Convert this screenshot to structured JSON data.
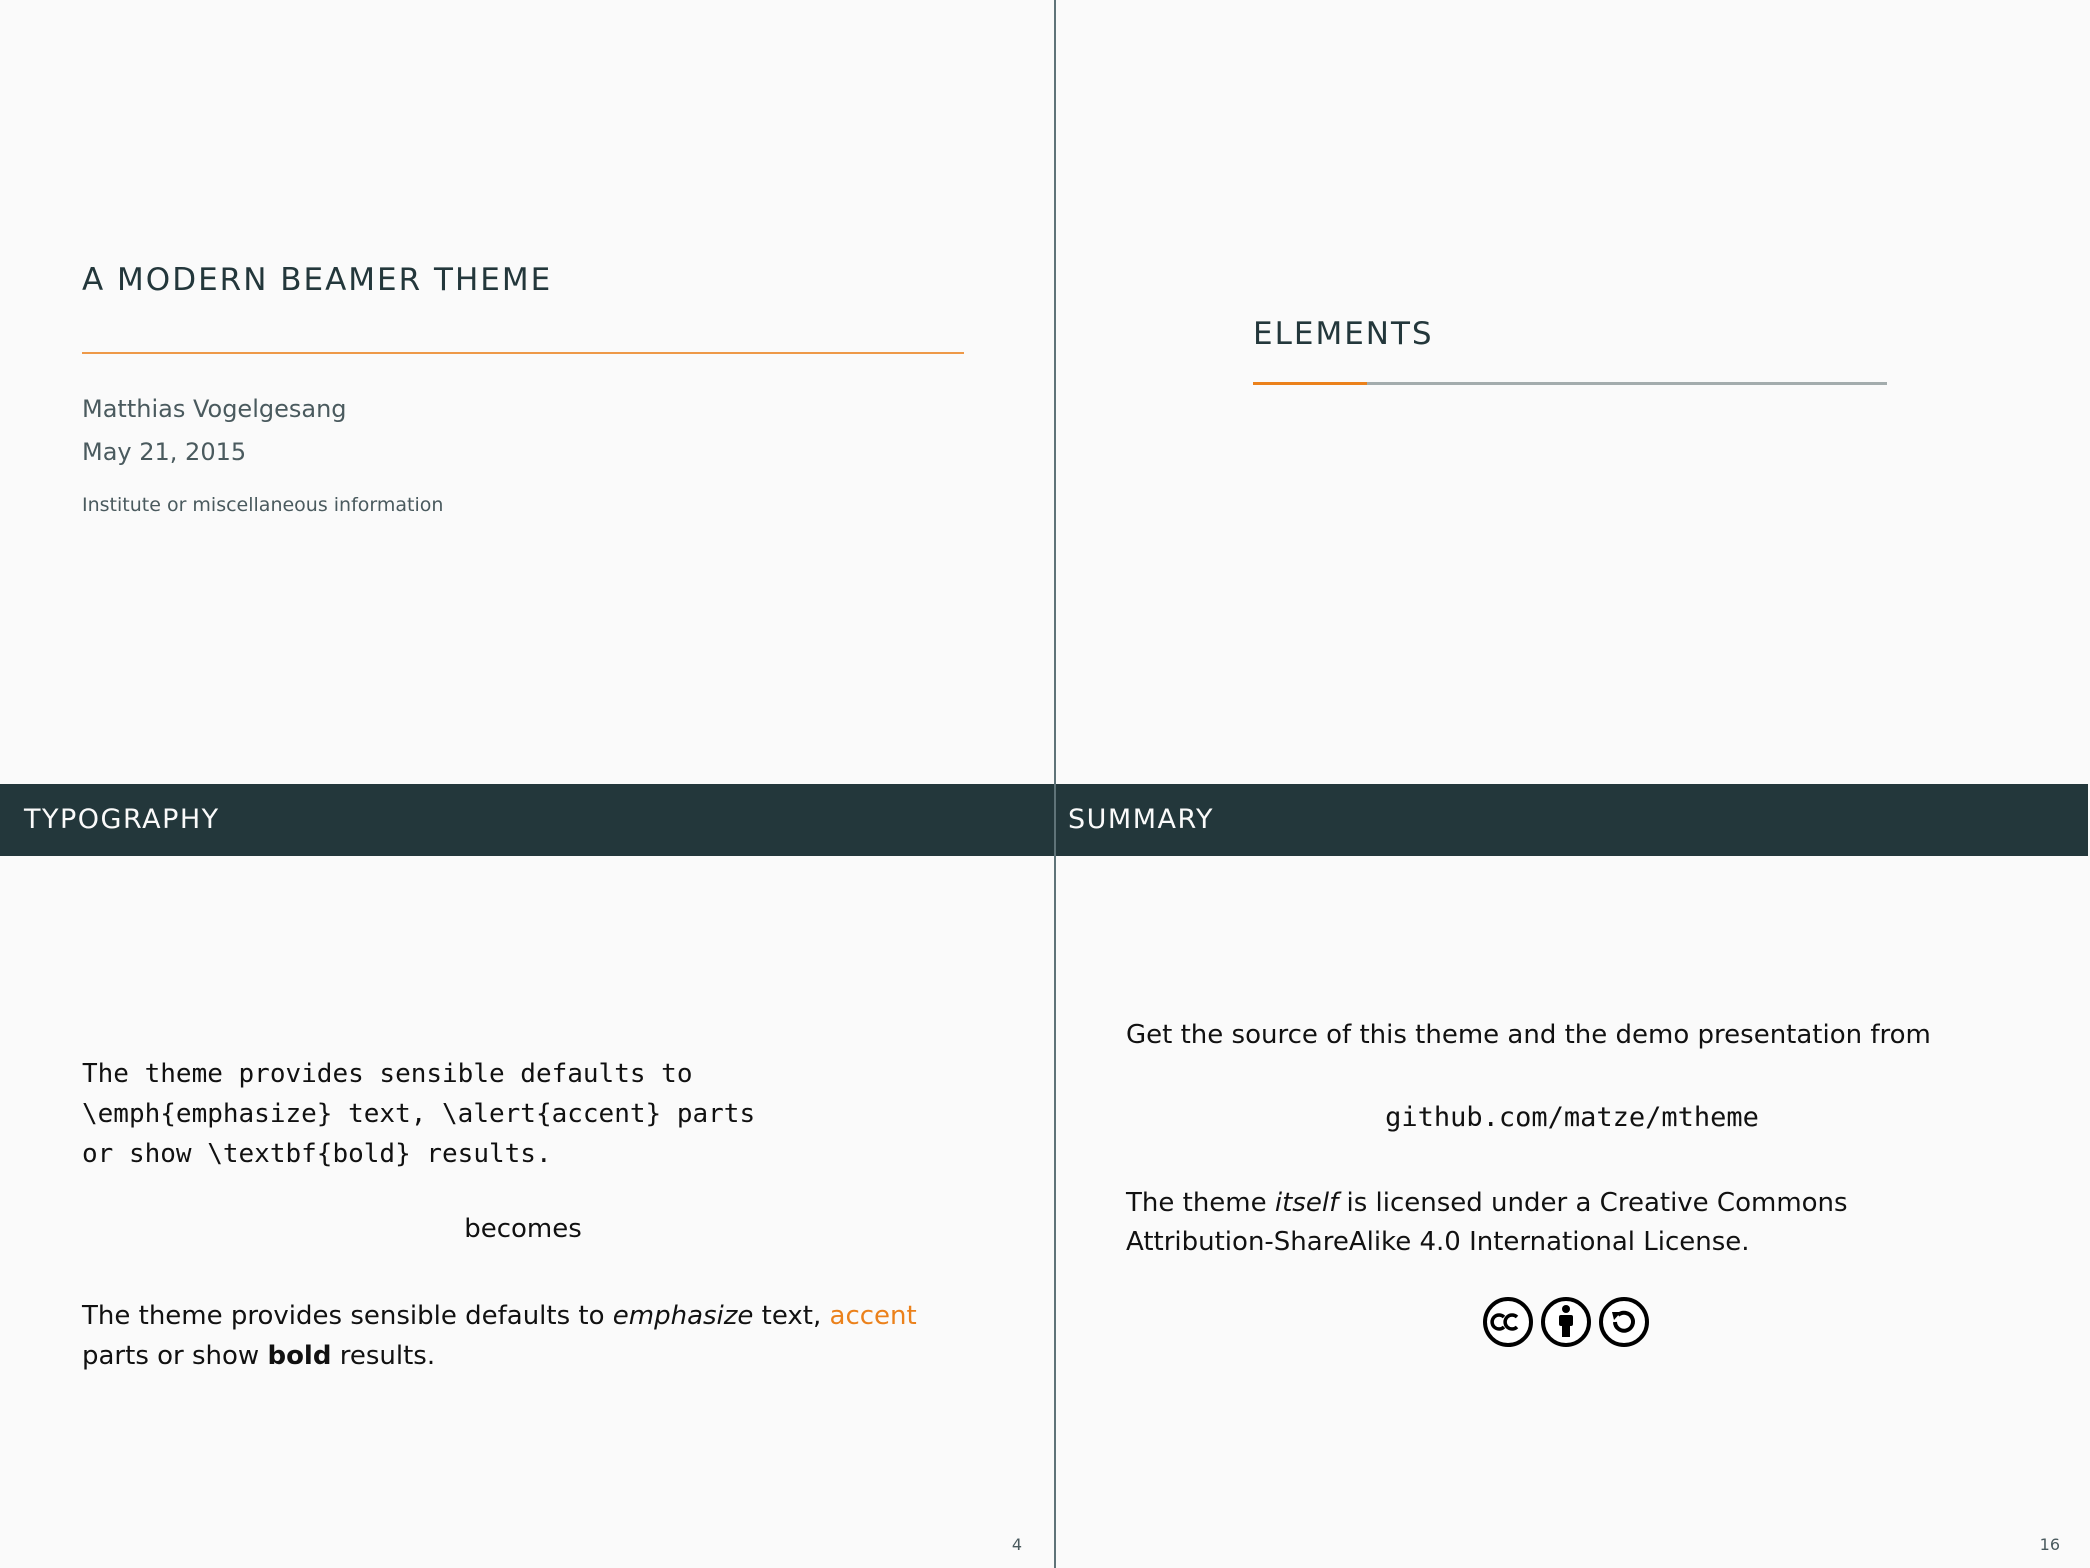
{
  "title_slide": {
    "title": "A MODERN BEAMER THEME",
    "author": "Matthias Vogelgesang",
    "date": "May 21, 2015",
    "institute": "Institute or miscellaneous information"
  },
  "section_slide": {
    "title": "ELEMENTS",
    "progress": 0.18
  },
  "typography_slide": {
    "frame_title": "TYPOGRAPHY",
    "code_lines": [
      "The theme provides sensible defaults to",
      "\\emph{emphasize} text, \\alert{accent} parts",
      "or show \\textbf{bold} results."
    ],
    "becomes": "becomes",
    "result": {
      "part1": "The theme provides sensible defaults to ",
      "emph": "emphasize",
      "part2": " text, ",
      "alert": "accent",
      "part3": " parts or show ",
      "bold": "bold",
      "part4": " results."
    },
    "page_number": "4"
  },
  "summary_slide": {
    "frame_title": "SUMMARY",
    "source_text": "Get the source of this theme and the demo presentation from",
    "url": "github.com/matze/mtheme",
    "license": {
      "part1": "The theme ",
      "emph": "itself",
      "part2": " is licensed under a Creative Commons",
      "line2": "Attribution-ShareAlike 4.0 International License."
    },
    "license_icons": [
      "cc-icon",
      "by-icon",
      "sa-icon"
    ],
    "page_number": "16"
  },
  "colors": {
    "dark_teal": "#23373b",
    "orange": "#eb811b",
    "background": "#fafafa"
  }
}
